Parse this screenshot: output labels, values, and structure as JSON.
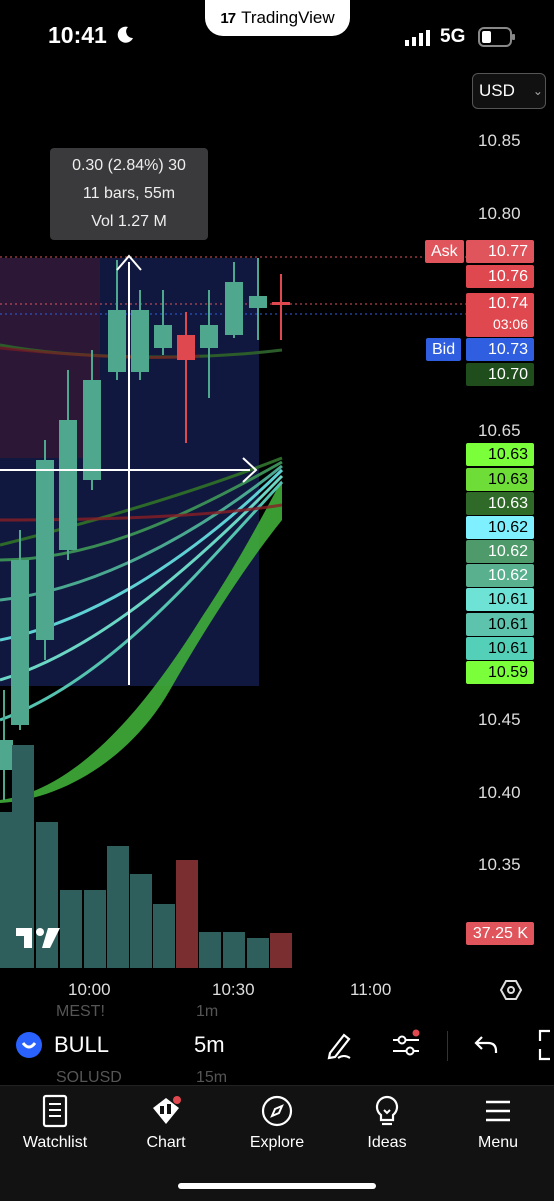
{
  "status_bar": {
    "time": "10:41",
    "network": "5G"
  },
  "top_pill": {
    "brand": "TradingView"
  },
  "currency": {
    "selected": "USD"
  },
  "price_axis": [
    "10.85",
    "10.80",
    "10.65",
    "10.45",
    "10.40",
    "10.35"
  ],
  "price_tags": {
    "ask_label": "Ask",
    "ask_value": "10.77",
    "p1": "10.76",
    "p2": "10.74",
    "countdown": "03:06",
    "bid_label": "Bid",
    "bid_value": "10.73",
    "p3": "10.70",
    "ma": [
      "10.63",
      "10.63",
      "10.63",
      "10.62",
      "10.62",
      "10.62",
      "10.61",
      "10.61",
      "10.61",
      "10.59"
    ],
    "volume": "37.25 K"
  },
  "time_axis": [
    "10:00",
    "10:30",
    "11:00"
  ],
  "measure_tooltip": {
    "line1": "0.30 (2.84%) 30",
    "line2": "11 bars, 55m",
    "line3": "Vol 1.27 M"
  },
  "symbol_bar": {
    "symbol": "BULL",
    "interval": "5m",
    "ghost_symbol_above": "MEST!",
    "ghost_interval_above": "1m",
    "ghost_symbol_below": "SOLUSD",
    "ghost_interval_below": "15m"
  },
  "tabs": [
    {
      "label": "Watchlist",
      "icon": "watchlist-icon"
    },
    {
      "label": "Chart",
      "icon": "chart-icon"
    },
    {
      "label": "Explore",
      "icon": "compass-icon"
    },
    {
      "label": "Ideas",
      "icon": "lightbulb-icon"
    },
    {
      "label": "Menu",
      "icon": "hamburger-icon"
    }
  ],
  "colors": {
    "bull": "#4fa88e",
    "bear": "#e0484f",
    "ask": "#e0555c",
    "bid": "#2f5fe0",
    "accent": "#2962ff"
  }
}
